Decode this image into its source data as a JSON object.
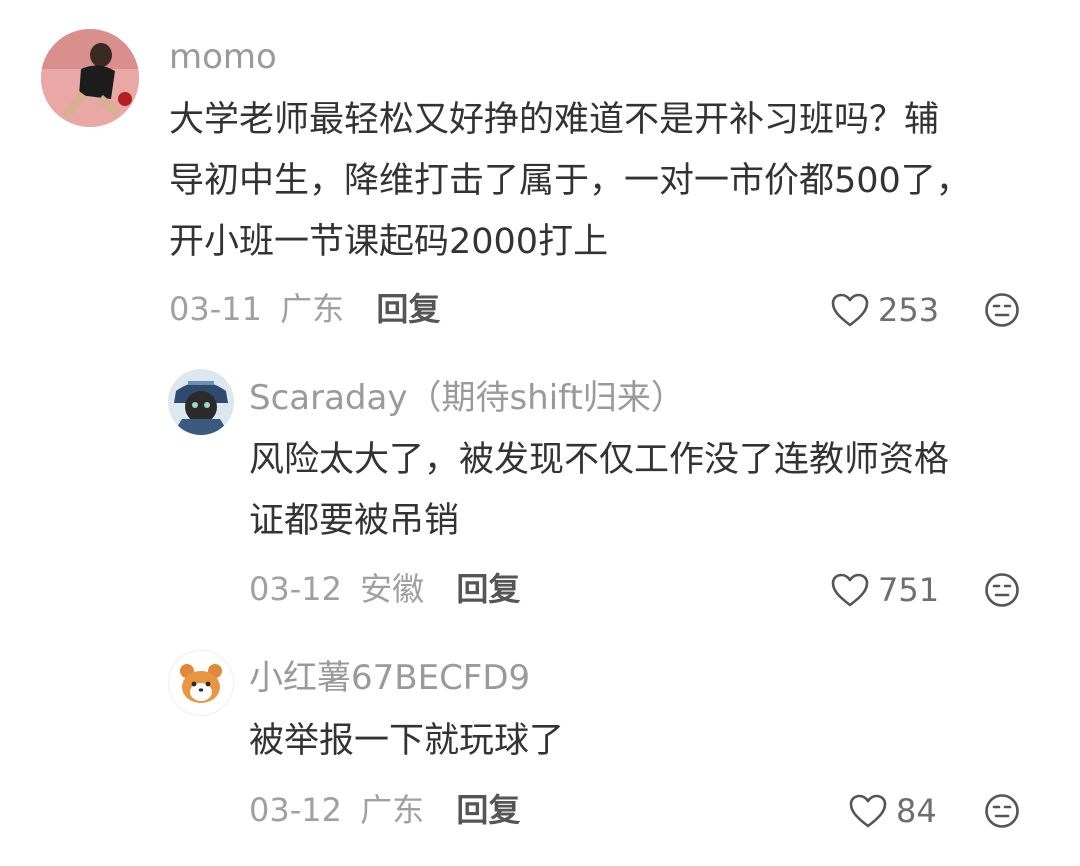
{
  "comments": [
    {
      "author": "momo",
      "text_lines": [
        "大学老师最轻松又好挣的难道不是开补习班吗？辅",
        "导初中生，降维打击了属于，一对一市价都500了，",
        "开小班一节课起码2000打上"
      ],
      "date": "03-11",
      "location": "广东",
      "reply_label": "回复",
      "likes": "253",
      "avatar_icon": "table-tennis-player-avatar"
    },
    {
      "author": "Scaraday（期待shift归来）",
      "text_lines": [
        "风险太大了，被发现不仅工作没了连教师资格",
        "证都要被吊销"
      ],
      "date": "03-12",
      "location": "安徽",
      "reply_label": "回复",
      "likes": "751",
      "avatar_icon": "anime-character-avatar"
    },
    {
      "author": "小红薯67BECFD9",
      "text_lines": [
        "被举报一下就玩球了"
      ],
      "date": "03-12",
      "location": "广东",
      "reply_label": "回复",
      "likes": "84",
      "avatar_icon": "hamster-avatar"
    }
  ],
  "colors": {
    "author": "#9a9a9a",
    "text": "#333333",
    "meta": "#a0a0a0",
    "reply": "#555555"
  }
}
